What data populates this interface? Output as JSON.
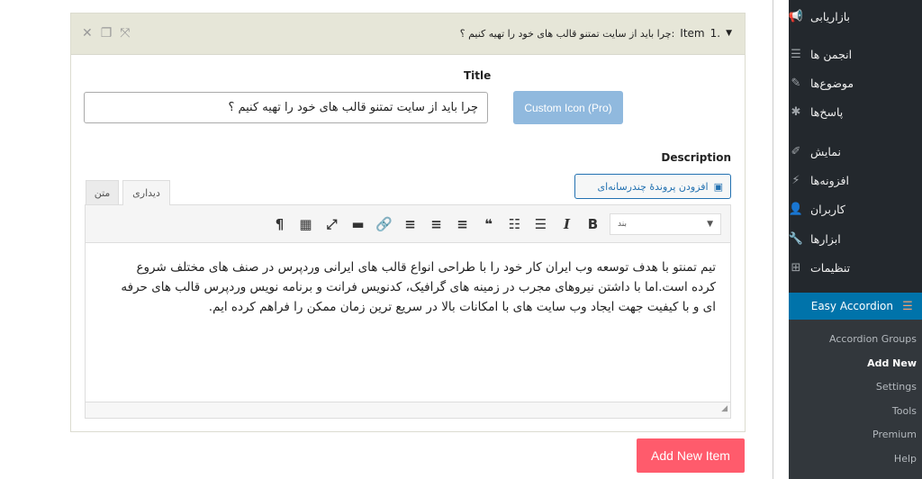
{
  "item": {
    "number": "1.",
    "prefix": "Item",
    "heading": ":چرا باید از سایت تمتنو قالب های خود را تهیه کنیم ؟"
  },
  "title_label": "Title",
  "title_value": "چرا باید از سایت تمتنو قالب های خود را تهیه کنیم ؟",
  "custom_icon_label": "Custom Icon (Pro)",
  "description_label": "Description",
  "add_media_label": "افزودن پروندهٔ چندرسانه‌ای",
  "tabs": {
    "visual": "دیداری",
    "text": "متن"
  },
  "format_select": "بند",
  "content": "تیم تمنتو با هدف توسعه وب ایران کار خود را با طراحی انواع قالب های ایرانی وردپرس در صنف های مختلف شروع کرده است.اما با داشتن نیروهای مجرب در زمینه های گرافیک، کدنویس فرانت و برنامه نویس وردپرس قالب های حرفه ای و با کیفیت جهت ایجاد وب سایت های با امکانات بالا در سریع ترین زمان ممکن را فراهم کرده ایم.",
  "add_item_label": "Add New Item",
  "sidebar": {
    "items": [
      {
        "label": "بازاریابی",
        "icon": "megaphone-icon"
      },
      {
        "label": "انجمن ها",
        "icon": "forum-icon"
      },
      {
        "label": "موضوع‌ها",
        "icon": "topics-icon"
      },
      {
        "label": "پاسخ‌ها",
        "icon": "replies-icon"
      },
      {
        "label": "نمایش",
        "icon": "brush-icon"
      },
      {
        "label": "افزونه‌ها",
        "icon": "plugin-icon"
      },
      {
        "label": "کاربران",
        "icon": "user-icon"
      },
      {
        "label": "ابزارها",
        "icon": "wrench-icon"
      },
      {
        "label": "تنظیمات",
        "icon": "settings-icon"
      }
    ],
    "active": "Easy Accordion",
    "submenu": [
      "Accordion Groups",
      "Add New",
      "Settings",
      "Tools",
      "Premium",
      "Help"
    ],
    "current_submenu": "Add New"
  },
  "colors": {
    "accent": "#0073aa",
    "add_button": "#ff5b6c",
    "custom_icon": "#90b9de"
  }
}
